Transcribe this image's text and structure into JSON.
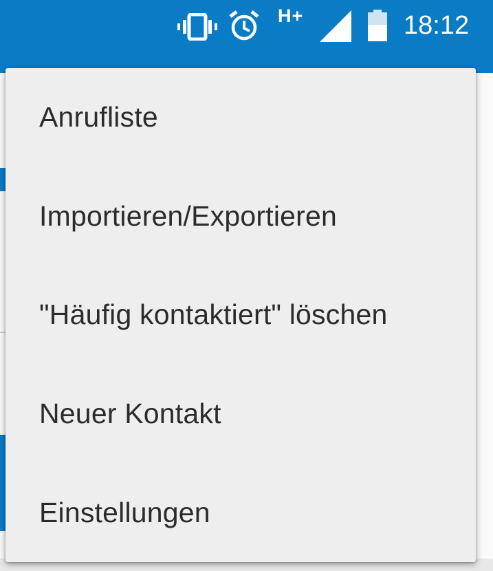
{
  "status_bar": {
    "network_type": "H+",
    "time": "18:12",
    "icons": [
      "vibrate-icon",
      "alarm-icon",
      "signal-icon",
      "battery-icon"
    ],
    "color": "#0a7cc6"
  },
  "menu": {
    "items": [
      {
        "label": "Anrufliste"
      },
      {
        "label": "Importieren/Exportieren"
      },
      {
        "label": "\"Häufig kontaktiert\" löschen"
      },
      {
        "label": "Neuer Kontakt"
      },
      {
        "label": "Einstellungen"
      }
    ]
  }
}
